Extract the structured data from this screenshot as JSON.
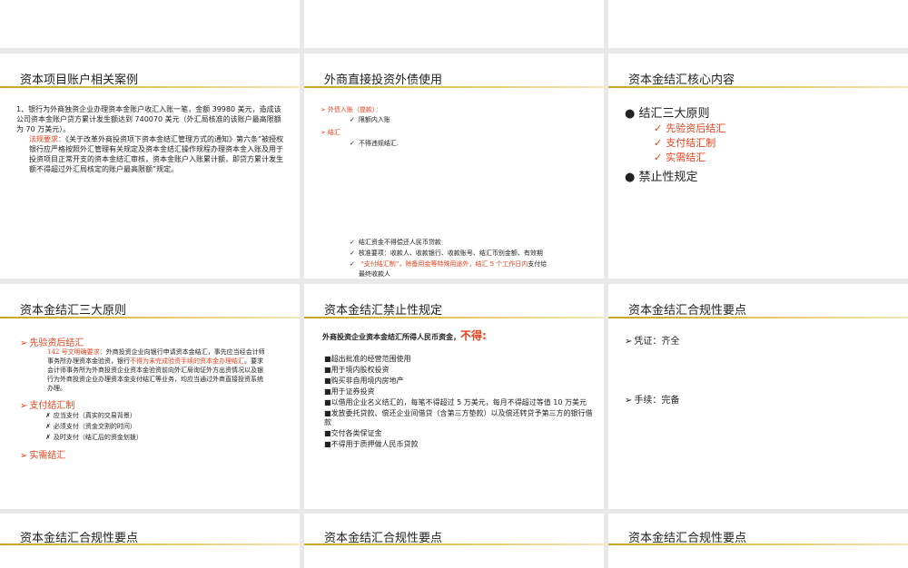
{
  "slides": {
    "s4": {
      "title": "资本项目账户相关案例",
      "item1": "1、银行为外商独资企业办理资本金账户收汇入账一笔，金额 39980 美元，造成该公司资本金账户贷方累计发生额达到 740070 美元（外汇局核准的该账户最高限额为 70 万美元）。",
      "req_label": "法规要求：",
      "req_text": "《关于改革外商投资项下资本金结汇管理方式的通知》第六条“被授权银行应严格按照外汇管理有关规定及资本金结汇操作规程办理资本金入账及用于投资项目正常开支的资本金结汇审核，资本金账户入账累计额，即贷方累计发生额不得超过外汇局核定的账户最高限额”规定。"
    },
    "s5": {
      "title": "外商直接投资外债使用",
      "inflow_label": "外债入账（提款）：",
      "inflow_check": "限额内入账",
      "settle_label": "结汇",
      "settle_check": "不得违规结汇.",
      "b1": "结汇资金不得偿还人民币贷款",
      "b2": "核准要项：收款人、收款银行、收款账号、结汇币别金额、有效期",
      "b3_red": "“支付结汇制”，除备用金等特殊用途外，结汇 5 个工作日内",
      "b3_rest": "支付给",
      "b3_line2": "最终收款人"
    },
    "s6": {
      "title": "资本金结汇核心内容",
      "p1": "结汇三大原则",
      "c1": "先验资后结汇",
      "c2": "支付结汇制",
      "c3": "实需结汇",
      "p2": "禁止性规定"
    },
    "s7": {
      "title": "资本金结汇三大原则",
      "h1": "先验资后结汇",
      "d1_red": "142 号文明确要求：",
      "d1_a": "外商投资企业向银行申请资本金结汇，事先应当经会计师事务所办理资本金验资，银行",
      "d1_red2": "不得为未完成验资手续的资本金办理结汇",
      "d1_b": "。要求会计师事务所为外商投资企业资本金验资前向外汇局询证外方出资情况以及银行为外商投资企业办理资本金支付结汇等业务，均应当通过外商直接投资系统办理。",
      "h2": "支付结汇制",
      "x1": "应当支付（真实的交易背景）",
      "x2": "必须支付（资金交割的时间）",
      "x3": "及时支付（结汇后的资金划拨）",
      "h3": "实需结汇"
    },
    "s8": {
      "title": "资本金结汇禁止性规定",
      "lead": "外商投资企业资本金结汇所得人民币资金，",
      "lead_red": "不得:",
      "items": [
        "超出批准的经营范围使用",
        "用于境内股权投资",
        "购买非自用境内房地产",
        "用于证券投资",
        "以借用企业名义结汇的，每笔不得超过 5 万美元，每月不得超过等值 10 万美元",
        "发放委托贷款、偿还企业间借贷（含第三方垫款）以及偿还转贷予第三方的银行借款",
        "交付各类保证金",
        "不得用于质押做人民币贷款"
      ]
    },
    "s9": {
      "title": "资本金结汇合规性要点",
      "p1": "凭证：齐全",
      "p2": "手续：完备"
    },
    "s10": {
      "title": "资本金结汇合规性要点"
    },
    "s11": {
      "title": "资本金结汇合规性要点"
    },
    "s12": {
      "title": "资本金结汇合规性要点"
    }
  }
}
